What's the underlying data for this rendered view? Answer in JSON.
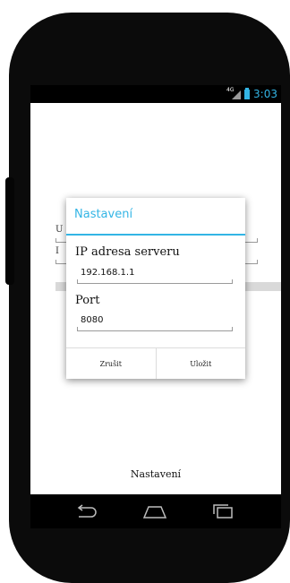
{
  "status_bar": {
    "network_label": "4G",
    "clock": "3:03",
    "accent_color": "#33b5e5"
  },
  "background_form": {
    "field1_label_initial": "U",
    "field2_label_initial": "I"
  },
  "bottom_label": "Nastavení",
  "dialog": {
    "title": "Nastavení",
    "ip_label": "IP adresa serveru",
    "ip_value": "192.168.1.1",
    "port_label": "Port",
    "port_value": "8080",
    "cancel_label": "Zrušit",
    "save_label": "Uložit"
  },
  "nav_icons": [
    "back-icon",
    "home-icon",
    "recent-apps-icon"
  ]
}
